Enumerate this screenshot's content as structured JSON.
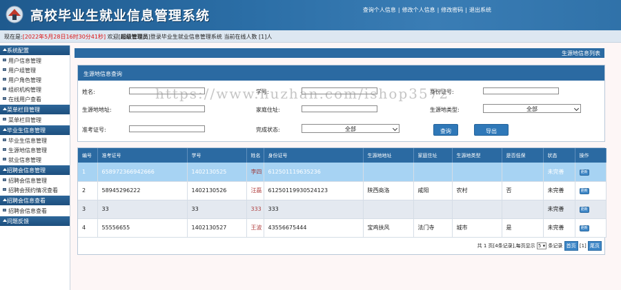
{
  "header": {
    "title": "高校毕业生就业信息管理系统",
    "links": [
      "查询个人信息",
      "修改个人信息",
      "修改密码",
      "退出系统"
    ]
  },
  "status": {
    "prefix": "现在是:",
    "datetime": "[2022年5月28日16时30分41秒]",
    "welcome": " 欢迎[",
    "role": "超级管理员",
    "suffix": "]登录毕业生就业信息管理系统 当前在线人数 [1]人"
  },
  "sidebar": [
    {
      "group": "系统配置",
      "items": [
        "用户信息管理",
        "用户组管理",
        "用户角色管理",
        "组织机构管理",
        "在线用户查看"
      ]
    },
    {
      "group": "菜单栏目管理",
      "items": [
        "菜单栏目管理"
      ]
    },
    {
      "group": "毕业生信息管理",
      "items": [
        "毕业生信息管理",
        "生源地信息管理",
        "就业信息管理"
      ]
    },
    {
      "group": "招聘会信息管理",
      "items": [
        "招聘会信息管理",
        "招聘会预约情况查看"
      ]
    },
    {
      "group": "招聘会信息查看",
      "items": [
        "招聘会信息查看"
      ]
    },
    {
      "group": "问题反馈",
      "items": []
    }
  ],
  "crumb": "生源地信息列表",
  "query": {
    "panel_title": "生源地信息查询",
    "name_label": "姓名:",
    "studentno_label": "学号:",
    "idcard_label": "身份证号:",
    "origin_label": "生源地地址:",
    "home_label": "家庭住址:",
    "origin_type_label": "生源地类型:",
    "origin_type_value": "全部",
    "exam_label": "准考证号:",
    "state_label": "完成状态:",
    "state_value": "全部",
    "search_button": "查询",
    "export_button": "导出"
  },
  "table": {
    "headers": [
      "编号",
      "准考证号",
      "学号",
      "姓名",
      "身份证号",
      "生源地地址",
      "家庭住址",
      "生源地类型",
      "是否低保",
      "状态",
      "操作"
    ],
    "rows": [
      [
        "1",
        "658972366942666",
        "1402130525",
        "李四",
        "612501119635236",
        "",
        "",
        "",
        "",
        "未完善",
        "更新"
      ],
      [
        "2",
        "58945296222",
        "1402130526",
        "汪磊",
        "612501199305241​23",
        "陕西商洛",
        "咸阳",
        "农村",
        "否",
        "未完善",
        "更新"
      ],
      [
        "3",
        "33",
        "33",
        "333",
        "333",
        "",
        "",
        "",
        "",
        "未完善",
        "更新"
      ],
      [
        "4",
        "55556655",
        "1402130527",
        "王波",
        "43556675444",
        "宝鸡扶风",
        "法门寺",
        "城市",
        "是",
        "未完善",
        "更新"
      ]
    ]
  },
  "pager": {
    "info": "共 1 页[4条记录],每页显示",
    "per_page": "5",
    "unit": "条记录",
    "first": "首页",
    "current": "[1]",
    "last": "尾页"
  },
  "watermark": "https://www.huzhan.com/ishop3572"
}
